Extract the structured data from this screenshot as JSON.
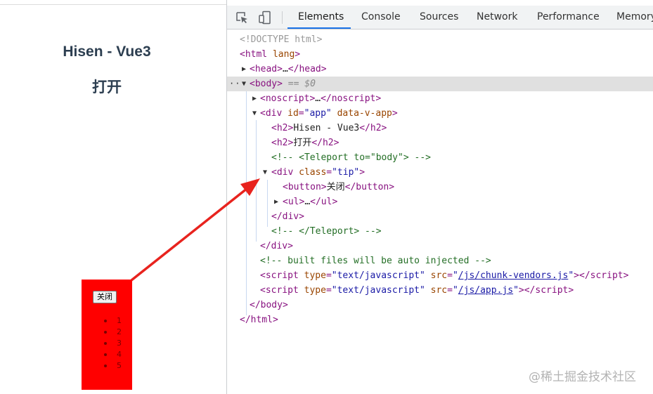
{
  "page": {
    "title": "Hisen - Vue3",
    "open_text": "打开",
    "tip": {
      "button_label": "关闭",
      "items": [
        "1",
        "2",
        "3",
        "4",
        "5"
      ]
    }
  },
  "devtools": {
    "tabs": [
      {
        "label": "Elements",
        "active": true
      },
      {
        "label": "Console",
        "active": false
      },
      {
        "label": "Sources",
        "active": false
      },
      {
        "label": "Network",
        "active": false
      },
      {
        "label": "Performance",
        "active": false
      },
      {
        "label": "Memory",
        "active": false
      }
    ],
    "tree": {
      "doctype": "<!DOCTYPE html>",
      "html_open": "html",
      "html_attr": "lang",
      "head": "head",
      "ellipsis": "…",
      "body": "body",
      "body_ref": "== $0",
      "noscript": "noscript",
      "div": "div",
      "id_attr": "id",
      "id_val": "\"app\"",
      "data_v_app": "data-v-app",
      "h2": "h2",
      "h2_text_1": "Hisen - Vue3",
      "h2_text_2": "打开",
      "comment_teleport_open": "<!-- <Teleport to=\"body\"> -->",
      "class_attr": "class",
      "class_val": "\"tip\"",
      "button": "button",
      "button_text": "关闭",
      "ul": "ul",
      "comment_teleport_close": "<!-- </Teleport> -->",
      "comment_injected": "<!-- built files will be auto injected -->",
      "script": "script",
      "type_attr": "type",
      "type_val": "\"text/javascript\"",
      "src_attr": "src",
      "src_vendors": "/js/chunk-vendors.js",
      "src_app": "/js/app.js"
    }
  },
  "watermark": "@稀土掘金技术社区",
  "colors": {
    "tip_background": "#ff0000",
    "arrow": "#e8231e",
    "tab_active_underline": "#1a73e8",
    "tag": "#881280",
    "attr_name": "#994500",
    "attr_value": "#1a1aa6",
    "comment": "#236e25"
  },
  "icons": [
    "inspect-element-icon",
    "device-toolbar-icon"
  ]
}
